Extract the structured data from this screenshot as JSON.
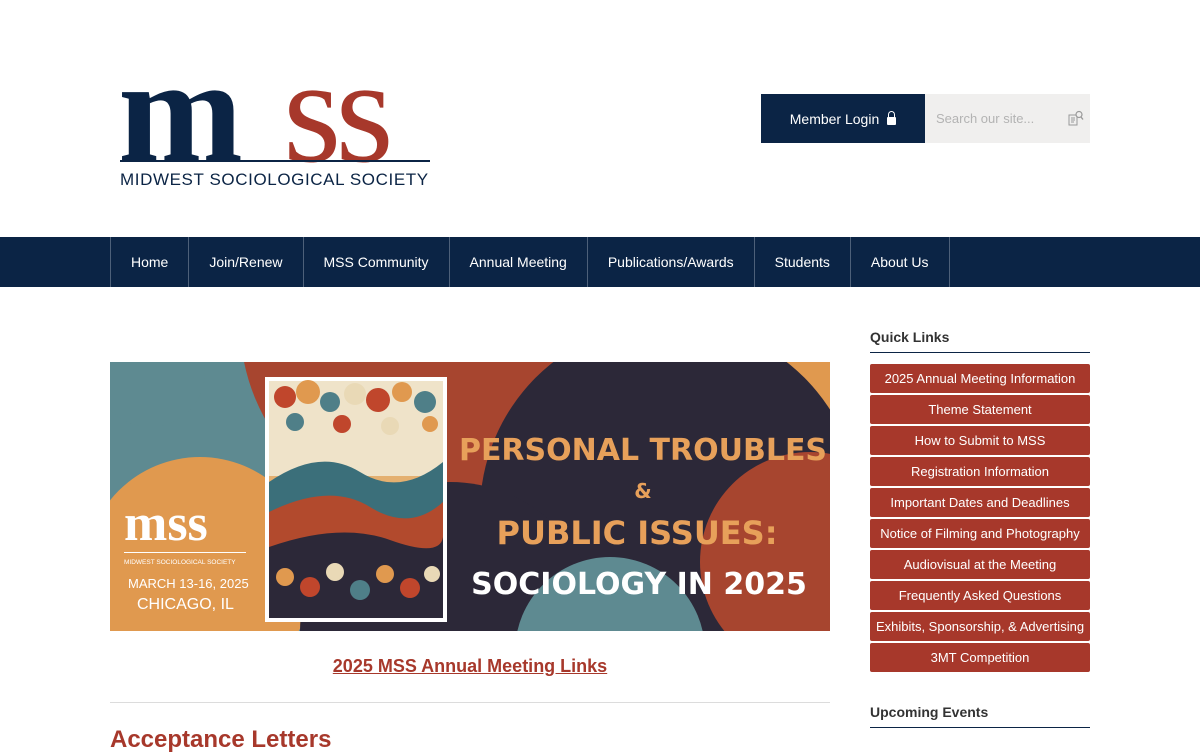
{
  "logo": {
    "letters_m": "m",
    "letters_ss": "ss",
    "subtitle": "MIDWEST SOCIOLOGICAL SOCIETY",
    "alt": "mss"
  },
  "header": {
    "login_label": "Member Login",
    "lock_icon": "lock-icon",
    "search_placeholder": "Search our site...",
    "search_icon": "search-icon"
  },
  "nav": {
    "items": [
      "Home",
      "Join/Renew",
      "MSS Community",
      "Annual Meeting",
      "Publications/Awards",
      "Students",
      "About Us"
    ]
  },
  "banner": {
    "logo_text": "mss",
    "logo_sub": "MIDWEST SOCIOLOGICAL SOCIETY",
    "dates": "MARCH 13-16, 2025",
    "location": "CHICAGO, IL",
    "line1": "PERSONAL TROUBLES",
    "amp": "&",
    "line2": "PUBLIC ISSUES:",
    "line3": "SOCIOLOGY IN 2025"
  },
  "main": {
    "meeting_link": "2025 MSS Annual Meeting Links",
    "section_title": "Acceptance Letters"
  },
  "sidebar": {
    "quick_links_title": "Quick Links",
    "quick_links": [
      "2025 Annual Meeting Information",
      "Theme Statement",
      "How to Submit to MSS",
      "Registration Information",
      "Important Dates and Deadlines",
      "Notice of Filming and Photography",
      "Audiovisual at the Meeting",
      "Frequently Asked Questions",
      "Exhibits, Sponsorship, & Advertising",
      "3MT Competition"
    ],
    "upcoming_title": "Upcoming Events"
  },
  "colors": {
    "navy": "#0b2445",
    "brick": "#a7382b",
    "orange": "#e0994f",
    "teal": "#5e8a91"
  }
}
